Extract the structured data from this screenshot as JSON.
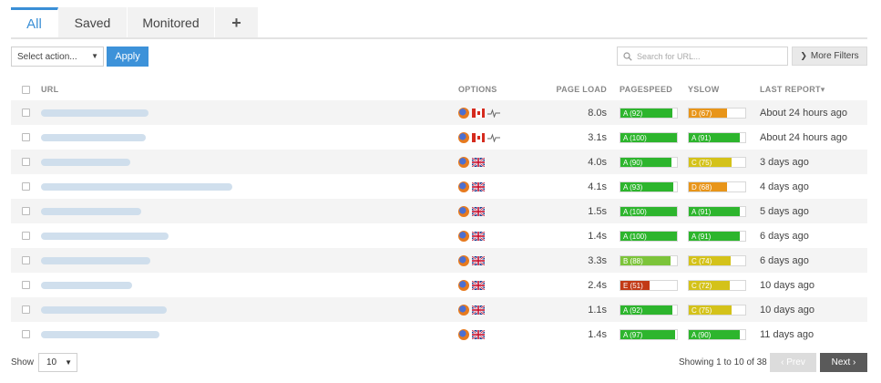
{
  "tabs": [
    {
      "label": "All",
      "active": true
    },
    {
      "label": "Saved",
      "active": false
    },
    {
      "label": "Monitored",
      "active": false
    },
    {
      "label": "+",
      "active": false
    }
  ],
  "toolbar": {
    "select_action": "Select action...",
    "apply_label": "Apply",
    "search_placeholder": "Search for URL...",
    "more_filters_label": "More Filters"
  },
  "table": {
    "headers": {
      "url": "URL",
      "options": "OPTIONS",
      "page_load": "PAGE LOAD",
      "pagespeed": "PAGESPEED",
      "yslow": "YSLOW",
      "last_report": "LAST REPORT▾"
    },
    "rows": [
      {
        "location": "ca",
        "monitored": true,
        "page_load": "8.0s",
        "pagespeed": {
          "label": "A (92)",
          "score": 92,
          "color": "#2db52d"
        },
        "yslow": {
          "label": "D (67)",
          "score": 67,
          "color": "#e8951a"
        },
        "last_report": "About 24 hours ago"
      },
      {
        "location": "ca",
        "monitored": true,
        "page_load": "3.1s",
        "pagespeed": {
          "label": "A (100)",
          "score": 100,
          "color": "#2db52d"
        },
        "yslow": {
          "label": "A (91)",
          "score": 91,
          "color": "#2db52d"
        },
        "last_report": "About 24 hours ago"
      },
      {
        "location": "uk",
        "monitored": false,
        "page_load": "4.0s",
        "pagespeed": {
          "label": "A (90)",
          "score": 90,
          "color": "#2db52d"
        },
        "yslow": {
          "label": "C (75)",
          "score": 75,
          "color": "#d4c21a"
        },
        "last_report": "3 days ago"
      },
      {
        "location": "uk",
        "monitored": false,
        "page_load": "4.1s",
        "pagespeed": {
          "label": "A (93)",
          "score": 93,
          "color": "#2db52d"
        },
        "yslow": {
          "label": "D (68)",
          "score": 68,
          "color": "#e8951a"
        },
        "last_report": "4 days ago"
      },
      {
        "location": "uk",
        "monitored": false,
        "page_load": "1.5s",
        "pagespeed": {
          "label": "A (100)",
          "score": 100,
          "color": "#2db52d"
        },
        "yslow": {
          "label": "A (91)",
          "score": 91,
          "color": "#2db52d"
        },
        "last_report": "5 days ago"
      },
      {
        "location": "uk",
        "monitored": false,
        "page_load": "1.4s",
        "pagespeed": {
          "label": "A (100)",
          "score": 100,
          "color": "#2db52d"
        },
        "yslow": {
          "label": "A (91)",
          "score": 91,
          "color": "#2db52d"
        },
        "last_report": "6 days ago"
      },
      {
        "location": "uk",
        "monitored": false,
        "page_load": "3.3s",
        "pagespeed": {
          "label": "B (88)",
          "score": 88,
          "color": "#7cc43a"
        },
        "yslow": {
          "label": "C (74)",
          "score": 74,
          "color": "#d4c21a"
        },
        "last_report": "6 days ago"
      },
      {
        "location": "uk",
        "monitored": false,
        "page_load": "2.4s",
        "pagespeed": {
          "label": "E (51)",
          "score": 51,
          "color": "#c23a16"
        },
        "yslow": {
          "label": "C (72)",
          "score": 72,
          "color": "#d4c21a"
        },
        "last_report": "10 days ago"
      },
      {
        "location": "uk",
        "monitored": false,
        "page_load": "1.1s",
        "pagespeed": {
          "label": "A (92)",
          "score": 92,
          "color": "#2db52d"
        },
        "yslow": {
          "label": "C (75)",
          "score": 75,
          "color": "#d4c21a"
        },
        "last_report": "10 days ago"
      },
      {
        "location": "uk",
        "monitored": false,
        "page_load": "1.4s",
        "pagespeed": {
          "label": "A (97)",
          "score": 97,
          "color": "#2db52d"
        },
        "yslow": {
          "label": "A (90)",
          "score": 90,
          "color": "#2db52d"
        },
        "last_report": "11 days ago"
      }
    ]
  },
  "footer": {
    "show_label": "Show",
    "page_size": "10",
    "showing_text": "Showing 1 to 10 of 38",
    "prev_label": "‹ Prev",
    "next_label": "Next ›"
  },
  "colors": {
    "accent": "#3a8fd6"
  }
}
